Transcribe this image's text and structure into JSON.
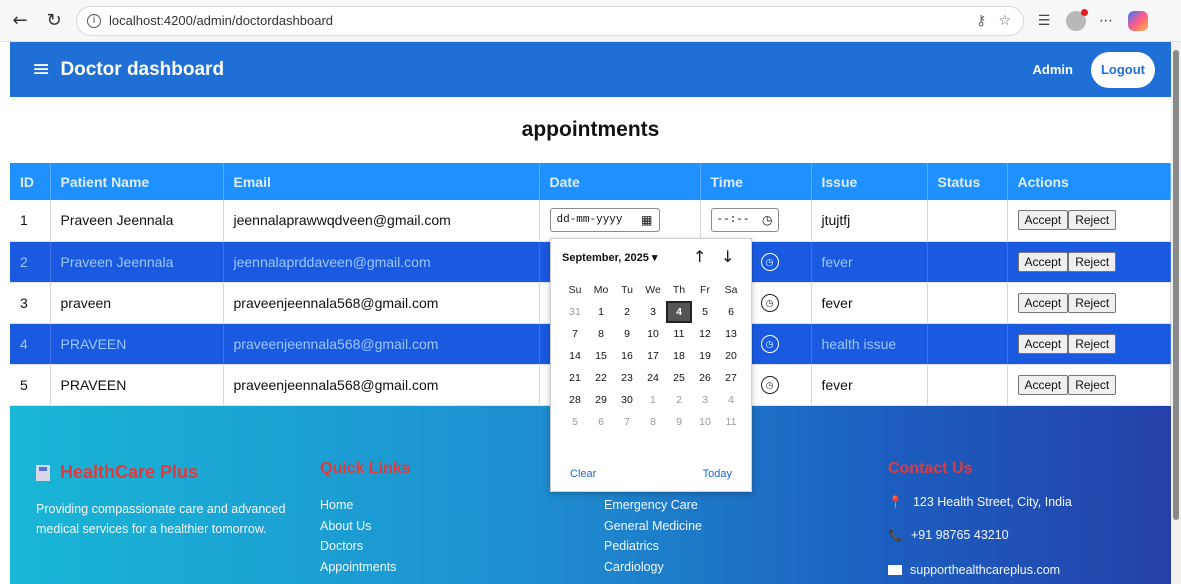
{
  "browser": {
    "url": "localhost:4200/admin/doctordashboard"
  },
  "header": {
    "title": "Doctor dashboard",
    "user": "Admin",
    "logout_label": "Logout"
  },
  "main": {
    "heading": "appointments",
    "columns": [
      "ID",
      "Patient Name",
      "Email",
      "Date",
      "Time",
      "Issue",
      "Status",
      "Actions"
    ],
    "rows": [
      {
        "id": "1",
        "name": "Praveen Jeennala",
        "email": "jeennalaprawwqdveen@gmail.com",
        "issue": "jtujtfj",
        "status": ""
      },
      {
        "id": "2",
        "name": "Praveen Jeennala",
        "email": "jeennalaprddaveen@gmail.com",
        "issue": "fever",
        "status": ""
      },
      {
        "id": "3",
        "name": "praveen",
        "email": "praveenjeennala568@gmail.com",
        "issue": "fever",
        "status": ""
      },
      {
        "id": "4",
        "name": "PRAVEEN",
        "email": "praveenjeennala568@gmail.com",
        "issue": "health issue",
        "status": ""
      },
      {
        "id": "5",
        "name": "PRAVEEN",
        "email": "praveenjeennala568@gmail.com",
        "issue": "fever",
        "status": ""
      }
    ],
    "date_placeholder": "dd-mm-yyyy",
    "time_placeholder": "--:--",
    "accept_label": "Accept",
    "reject_label": "Reject"
  },
  "datepicker": {
    "month_label": "September, 2025 ▾",
    "weekdays": [
      "Su",
      "Mo",
      "Tu",
      "We",
      "Th",
      "Fr",
      "Sa"
    ],
    "days": [
      [
        "31",
        "1",
        "2",
        "3",
        "4",
        "5",
        "6"
      ],
      [
        "7",
        "8",
        "9",
        "10",
        "11",
        "12",
        "13"
      ],
      [
        "14",
        "15",
        "16",
        "17",
        "18",
        "19",
        "20"
      ],
      [
        "21",
        "22",
        "23",
        "24",
        "25",
        "26",
        "27"
      ],
      [
        "28",
        "29",
        "30",
        "1",
        "2",
        "3",
        "4"
      ],
      [
        "5",
        "6",
        "7",
        "8",
        "9",
        "10",
        "11"
      ]
    ],
    "selected_day": "4",
    "clear_label": "Clear",
    "today_label": "Today"
  },
  "footer": {
    "brand": "HealthCare Plus",
    "tagline": "Providing compassionate care and advanced medical services for a healthier tomorrow.",
    "quick_links_title": "Quick Links",
    "quick_links": [
      "Home",
      "About Us",
      "Doctors",
      "Appointments"
    ],
    "services": [
      "Emergency Care",
      "General Medicine",
      "Pediatrics",
      "Cardiology"
    ],
    "contact_title": "Contact Us",
    "address": "123 Health Street, City, India",
    "phone": "+91 98765 43210",
    "email": "supporthealthcareplus.com"
  },
  "colors": {
    "header_bg": "#1f6fd6",
    "table_header_bg": "#1e90ff",
    "alt_row_bg": "#1a5ae0",
    "footer_heading": "#e03a3a"
  }
}
